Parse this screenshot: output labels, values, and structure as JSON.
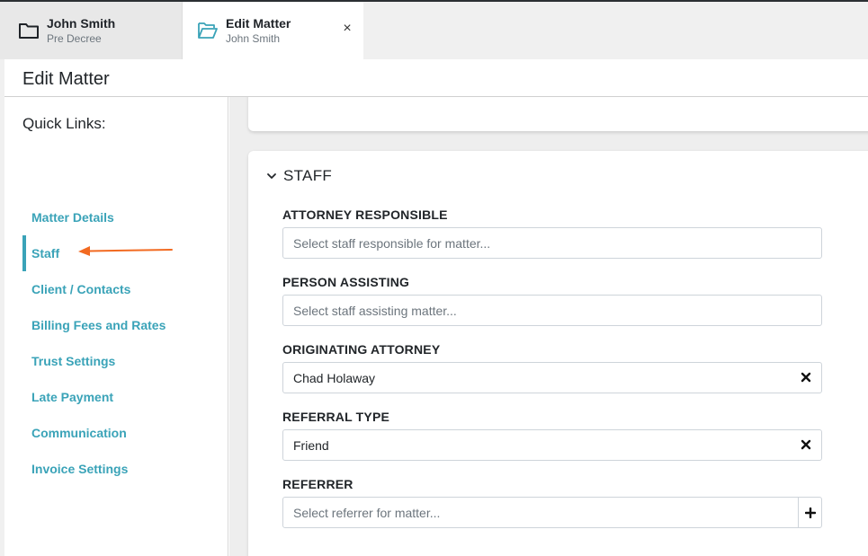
{
  "tabs": [
    {
      "title": "John Smith",
      "subtitle": "Pre Decree",
      "icon": "folder-icon"
    },
    {
      "title": "Edit Matter",
      "subtitle": "John Smith",
      "icon": "folder-open-icon",
      "close": "×"
    }
  ],
  "page": {
    "title": "Edit Matter"
  },
  "quick_links": {
    "title": "Quick Links:",
    "items": [
      {
        "label": "Matter Details"
      },
      {
        "label": "Staff",
        "active": true
      },
      {
        "label": "Client / Contacts"
      },
      {
        "label": "Billing Fees and Rates"
      },
      {
        "label": "Trust Settings"
      },
      {
        "label": "Late Payment"
      },
      {
        "label": "Communication"
      },
      {
        "label": "Invoice Settings"
      }
    ]
  },
  "staff_section": {
    "title": "STAFF",
    "fields": {
      "attorney_responsible": {
        "label": "ATTORNEY RESPONSIBLE",
        "placeholder": "Select staff responsible for matter..."
      },
      "person_assisting": {
        "label": "PERSON ASSISTING",
        "placeholder": "Select staff assisting matter..."
      },
      "originating_attorney": {
        "label": "ORIGINATING ATTORNEY",
        "value": "Chad Holaway"
      },
      "referral_type": {
        "label": "REFERRAL TYPE",
        "value": "Friend"
      },
      "referrer": {
        "label": "REFERRER",
        "placeholder": "Select referrer for matter..."
      }
    }
  },
  "colors": {
    "accent": "#3aa3b8",
    "annotation_arrow": "#f26a21",
    "folder_open_icon": "#3aa3b8"
  }
}
